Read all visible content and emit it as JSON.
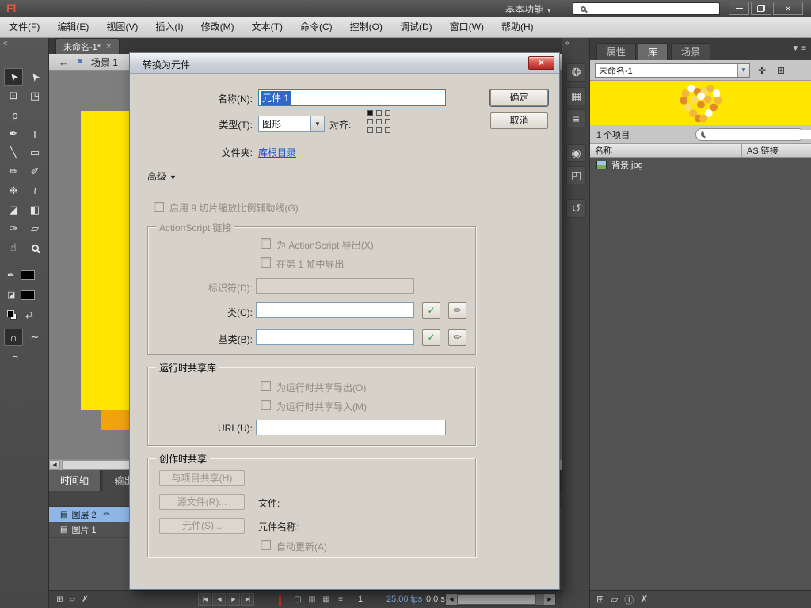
{
  "app": {
    "logo": "Fl",
    "workspace": "基本功能",
    "workspace_arrow": "▾",
    "search_value": "",
    "window_close": "×"
  },
  "menubar": {
    "items": [
      "文件(F)",
      "编辑(E)",
      "视图(V)",
      "插入(I)",
      "修改(M)",
      "文本(T)",
      "命令(C)",
      "控制(O)",
      "调试(D)",
      "窗口(W)",
      "帮助(H)"
    ]
  },
  "document": {
    "tab_title": "未命名-1*",
    "tab_close": "×",
    "back_arrow": "←",
    "scene_icon": "⚑",
    "scene_label": "场景 1",
    "hscroll_left": "◀"
  },
  "tools": [
    {
      "name": "selection-tool",
      "glyph": "➤"
    },
    {
      "name": "subselection-tool",
      "glyph": "➤"
    },
    {
      "name": "free-transform-tool",
      "glyph": "⊡"
    },
    {
      "name": "gradient-transform-tool",
      "glyph": "◳"
    },
    {
      "name": "lasso-tool",
      "glyph": "ρ"
    },
    {
      "name": "pen-tool",
      "glyph": "✒"
    },
    {
      "name": "text-tool",
      "glyph": "T"
    },
    {
      "name": "line-tool",
      "glyph": "╲"
    },
    {
      "name": "rectangle-tool",
      "glyph": "▭"
    },
    {
      "name": "pencil-tool",
      "glyph": "✏"
    },
    {
      "name": "brush-tool",
      "glyph": "✐"
    },
    {
      "name": "deco-tool",
      "glyph": "❉"
    },
    {
      "name": "bone-tool",
      "glyph": "≀"
    },
    {
      "name": "paint-bucket-tool",
      "glyph": "◪"
    },
    {
      "name": "ink-bottle-tool",
      "glyph": "◧"
    },
    {
      "name": "eyedropper-tool",
      "glyph": "✑"
    },
    {
      "name": "eraser-tool",
      "glyph": "▱"
    },
    {
      "name": "hand-tool",
      "glyph": "☝"
    },
    {
      "name": "zoom-tool",
      "glyph": ""
    },
    {
      "name": "stroke-color",
      "glyph": "✒"
    },
    {
      "name": "fill-color",
      "glyph": "◪"
    },
    {
      "name": "default-colors",
      "glyph": ""
    },
    {
      "name": "swap-colors",
      "glyph": "⇄"
    },
    {
      "name": "snap-magnet",
      "glyph": "∩"
    },
    {
      "name": "smooth",
      "glyph": "∼"
    },
    {
      "name": "straighten",
      "glyph": "¬"
    }
  ],
  "dock": [
    {
      "name": "color-panel",
      "glyph": "❂"
    },
    {
      "name": "swatches-panel",
      "glyph": "▦"
    },
    {
      "name": "align-panel",
      "glyph": "≡"
    },
    {
      "name": "info-panel",
      "glyph": "◉"
    },
    {
      "name": "transform-panel",
      "glyph": "◰"
    },
    {
      "name": "history-panel",
      "glyph": "↺"
    }
  ],
  "dialog": {
    "title": "转换为元件",
    "close_glyph": "×",
    "name_label": "名称(N):",
    "name_value": "元件 1",
    "ok": "确定",
    "cancel": "取消",
    "type_label": "类型(T):",
    "type_value": "图形",
    "type_arrow": "▼",
    "align_label": "对齐:",
    "folder_label": "文件夹:",
    "folder_link": "库根目录",
    "advanced": "高级",
    "advanced_arrow": "▼",
    "scale9": "启用 9 切片缩放比例辅助线(G)",
    "as_group": "ActionScript 链接",
    "export_as": "为 ActionScript 导出(X)",
    "export_frame1": "在第 1 帧中导出",
    "identifier_label": "标识符(D):",
    "class_label": "类(C):",
    "base_label": "基类(B):",
    "check_glyph": "✓",
    "pencil_glyph": "✏",
    "runtime_group": "运行时共享库",
    "runtime_export": "为运行时共享导出(O)",
    "runtime_import": "为运行时共享导入(M)",
    "url_label": "URL(U):",
    "author_group": "创作时共享",
    "share_project": "与项目共享(H)",
    "source_file": "源文件(R)...",
    "file_label": "文件:",
    "symbol_button": "元件(S)...",
    "symbol_name_label": "元件名称:",
    "auto_update": "自动更新(A)"
  },
  "timeline": {
    "tab_timeline": "时间轴",
    "tab_output": "输出",
    "layers": [
      {
        "name": "图层 2"
      },
      {
        "name": "图片 1"
      }
    ],
    "icons": {
      "layer": "▤",
      "pencil": "✏",
      "new_layer": "⊞",
      "new_folder": "▱",
      "delete": "✗"
    },
    "controls": {
      "first": "|◀",
      "prev": "◀",
      "play": "▶",
      "last": "▶|"
    },
    "onion": [
      "▢",
      "▥",
      "▦",
      "≡"
    ],
    "frame": "1",
    "fps": "25.00 fps",
    "elapsed": "0.0 s",
    "scroll_left": "◀",
    "scroll_right": "▶"
  },
  "library": {
    "tab_properties": "属性",
    "tab_library": "库",
    "tab_scene": "场景",
    "menu_arrow": "▼",
    "menu_icon": "≡",
    "doc_name": "未命名-1",
    "dropdown_arrow": "▼",
    "pin_glyph": "✜",
    "new_panel_glyph": "⊞",
    "count": "1 个项目",
    "col_name": "名称",
    "col_linkage": "AS 链接",
    "items": [
      {
        "name": "背景.jpg"
      }
    ],
    "bottom": {
      "new_symbol": "⊞",
      "new_folder": "▱",
      "properties": "ⓘ",
      "delete": "✗"
    }
  },
  "colors": {
    "selection_blue": "#3168c8",
    "stage_yellow": "#ffe600",
    "stage_orange": "#f2a20d",
    "layer_selected": "#8fb6e4"
  }
}
